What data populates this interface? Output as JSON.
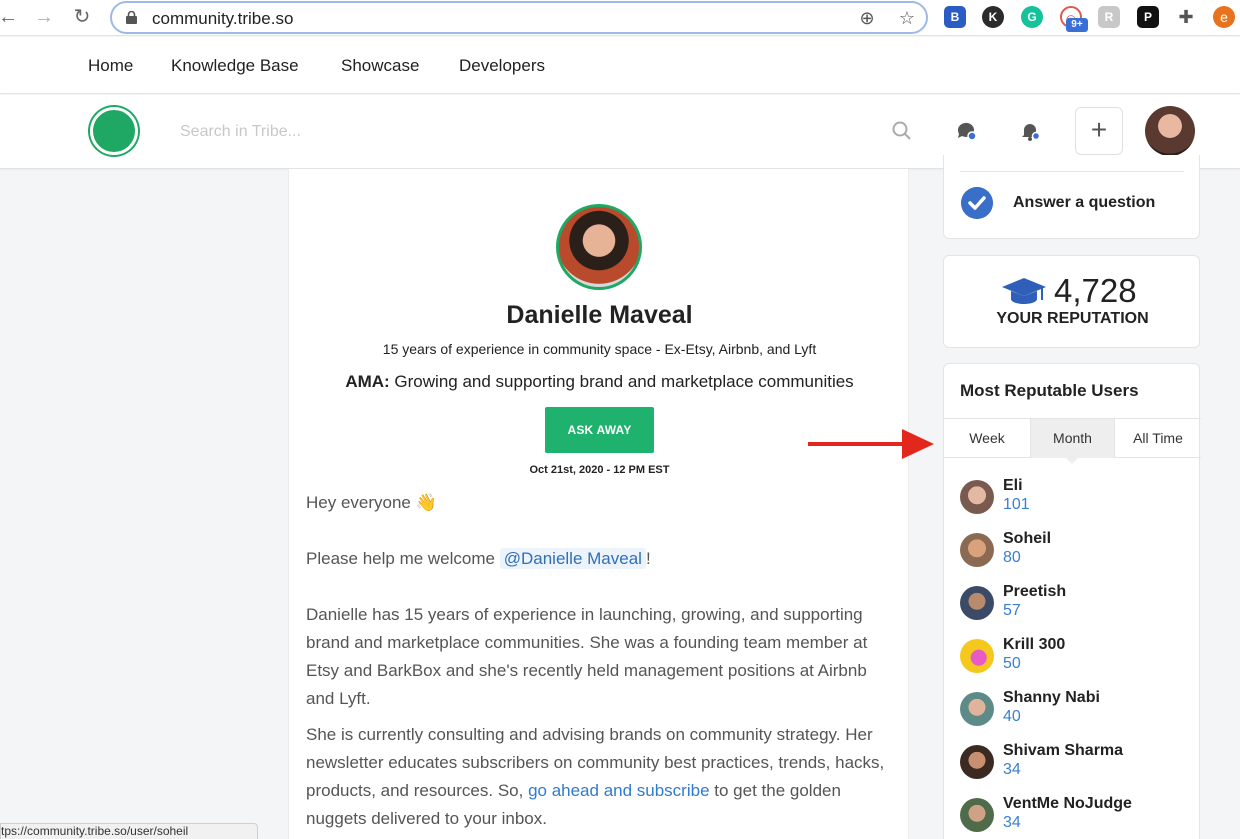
{
  "browser": {
    "url": "community.tribe.so",
    "status_url": "https://community.tribe.so/user/soheil",
    "ext_badge": "9+",
    "ext_avatar": "e"
  },
  "site_nav": {
    "items": [
      "Home",
      "Knowledge Base",
      "Showcase",
      "Developers"
    ]
  },
  "header": {
    "search_placeholder": "Search in Tribe..."
  },
  "post": {
    "author_name": "Danielle Maveal",
    "author_bio": "15 years of experience in community space - Ex-Etsy, Airbnb, and Lyft",
    "ama_label": "AMA:",
    "ama_topic": " Growing and supporting brand and marketplace communities",
    "ask_button": "ASK AWAY",
    "event_time": "Oct 21st, 2020 - 12 PM EST",
    "greeting": "Hey everyone 👋",
    "welcome_prefix": "Please help me welcome ",
    "welcome_mention": "@Danielle Maveal",
    "welcome_suffix": "!",
    "para1": "Danielle has 15 years of experience in launching, growing, and supporting brand and marketplace communities. She was a founding team member at Etsy and BarkBox and she's recently held management positions at Airbnb and Lyft.",
    "para2_before": "She is currently consulting and advising brands on community strategy. Her newsletter educates subscribers on community best practices, trends, hacks, products, and resources. So, ",
    "para2_link": "go ahead and subscribe",
    "para2_after": " to get the golden nuggets delivered to your inbox."
  },
  "sidebar": {
    "answer_label": "Answer a question",
    "reputation_value": "4,728",
    "reputation_label": "YOUR REPUTATION",
    "users_title": "Most Reputable Users",
    "tabs": [
      "Week",
      "Month",
      "All Time"
    ],
    "active_tab": "Month",
    "users": [
      {
        "name": "Eli",
        "score": "101",
        "color": "#7a5a4e"
      },
      {
        "name": "Soheil",
        "score": "80",
        "color": "#8a6a52"
      },
      {
        "name": "Preetish",
        "score": "57",
        "color": "#3b4a66"
      },
      {
        "name": "Krill 300",
        "score": "50",
        "color": "#f4c81d"
      },
      {
        "name": "Shanny Nabi",
        "score": "40",
        "color": "#5d8c88"
      },
      {
        "name": "Shivam Sharma",
        "score": "34",
        "color": "#6b4b3e"
      },
      {
        "name": "VentMe NoJudge",
        "score": "34",
        "color": "#4f6b4a"
      }
    ]
  },
  "colors": {
    "brand_green": "#1fb26e",
    "link_blue": "#2f7bd0",
    "arrow_red": "#e3271c"
  }
}
